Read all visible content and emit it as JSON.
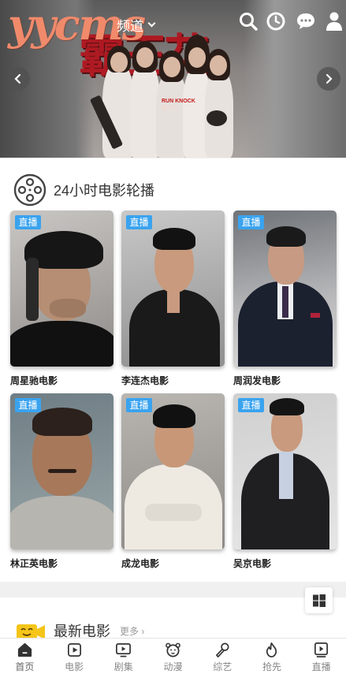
{
  "header": {
    "logo": "yycms",
    "channel_label": "频道",
    "icons": [
      "search-icon",
      "history-icon",
      "message-icon",
      "user-icon"
    ]
  },
  "banner": {
    "poster_title": "霸王花",
    "poster_sub_1": "RUN KNOCK",
    "poster_sub_2": "霸王花"
  },
  "section_live": {
    "title": "24小时电影轮播",
    "icon": "film-reel-icon",
    "badge": "直播",
    "cards": [
      {
        "name": "周星驰电影"
      },
      {
        "name": "李连杰电影"
      },
      {
        "name": "周润发电影"
      },
      {
        "name": "林正英电影"
      },
      {
        "name": "成龙电影"
      },
      {
        "name": "吴京电影"
      }
    ]
  },
  "section_new": {
    "title": "最新电影",
    "more": "更多 ›",
    "icon": "tv-icon"
  },
  "bottom_nav": [
    {
      "label": "首页",
      "icon": "home-icon"
    },
    {
      "label": "电影",
      "icon": "movie-icon"
    },
    {
      "label": "剧集",
      "icon": "tv-series-icon"
    },
    {
      "label": "动漫",
      "icon": "anime-icon"
    },
    {
      "label": "综艺",
      "icon": "variety-icon"
    },
    {
      "label": "抢先",
      "icon": "fire-icon"
    },
    {
      "label": "直播",
      "icon": "live-icon"
    }
  ],
  "colors": {
    "logo": "#f08a6b",
    "badge": "#3aa3ef",
    "tv_icon": "#f5c518"
  }
}
